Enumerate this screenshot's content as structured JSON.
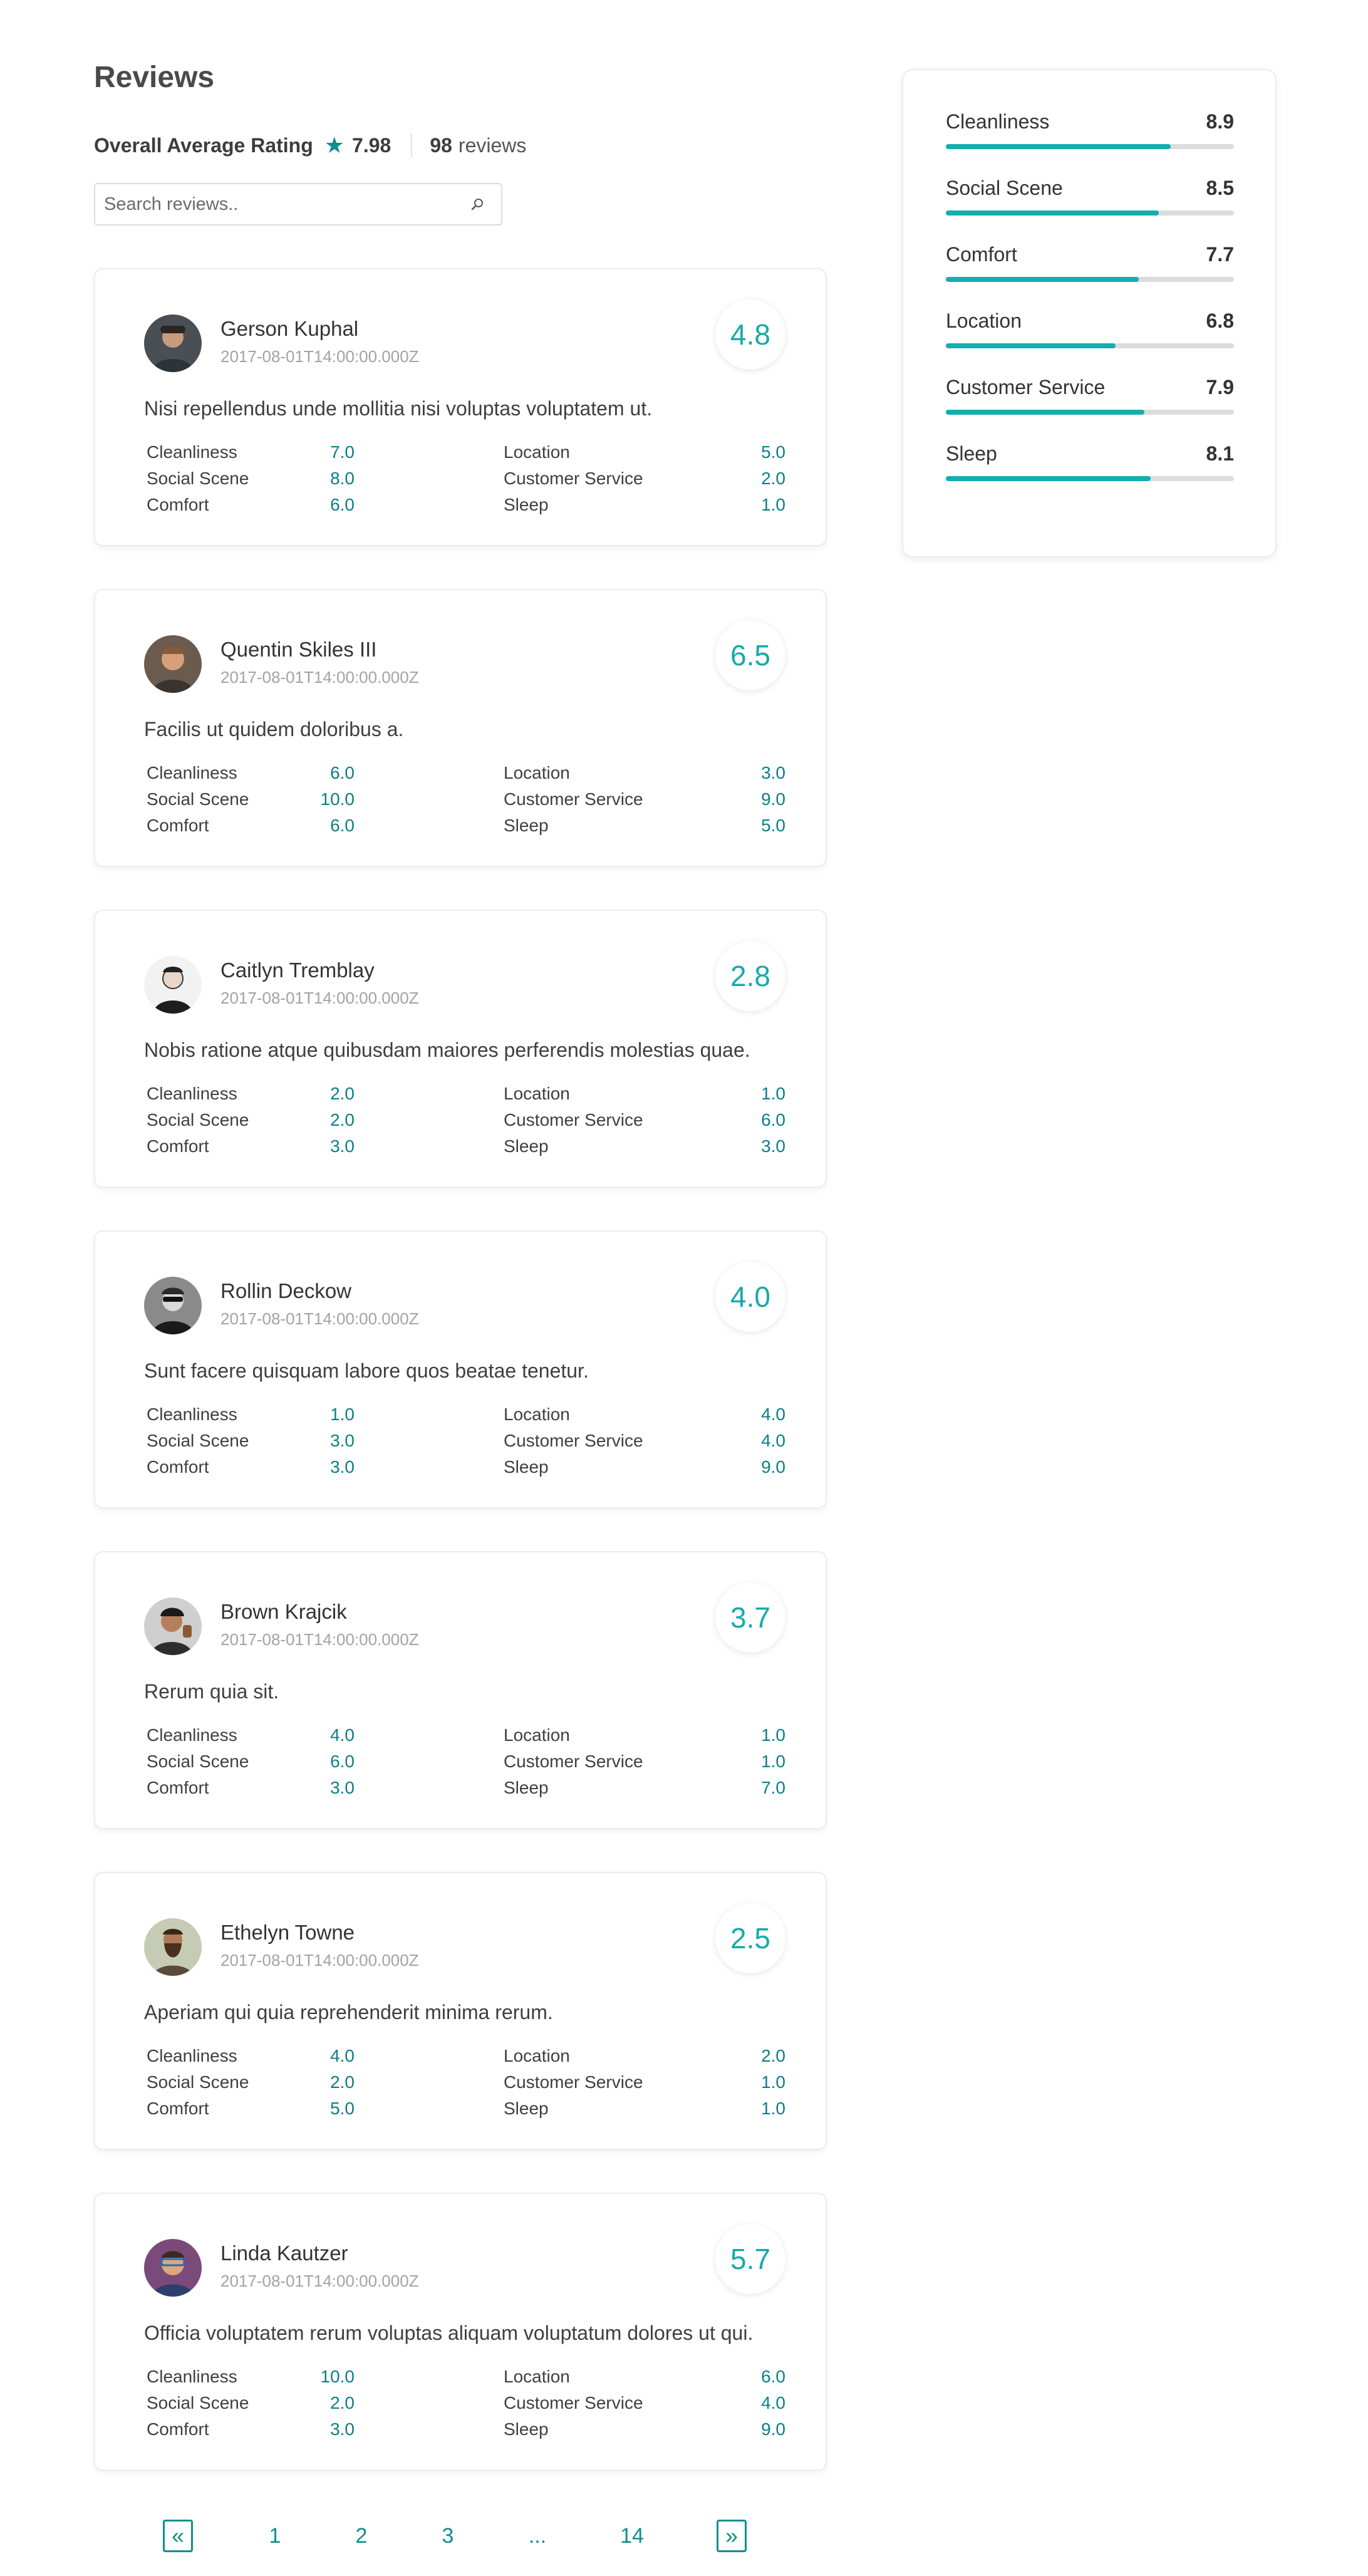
{
  "header": {
    "title": "Reviews",
    "overall_label": "Overall Average Rating",
    "overall_value": "7.98",
    "review_count": "98",
    "review_count_label": "reviews"
  },
  "search": {
    "placeholder": "Search reviews.."
  },
  "colors": {
    "accent": "#13aeae",
    "value_text": "#0a7f8a",
    "track": "#dcdcdc"
  },
  "summary": [
    {
      "label": "Cleanliness",
      "value": "8.9",
      "fraction": 0.78
    },
    {
      "label": "Social Scene",
      "value": "8.5",
      "fraction": 0.74
    },
    {
      "label": "Comfort",
      "value": "7.7",
      "fraction": 0.67
    },
    {
      "label": "Location",
      "value": "6.8",
      "fraction": 0.59
    },
    {
      "label": "Customer Service",
      "value": "7.9",
      "fraction": 0.69
    },
    {
      "label": "Sleep",
      "value": "8.1",
      "fraction": 0.71
    }
  ],
  "reviews": [
    {
      "name": "Gerson Kuphal",
      "date": "2017-08-01T14:00:00.000Z",
      "score": "4.8",
      "text": "Nisi repellendus unde mollitia nisi voluptas voluptatem ut.",
      "left": [
        [
          "Cleanliness",
          "7.0"
        ],
        [
          "Social Scene",
          "8.0"
        ],
        [
          "Comfort",
          "6.0"
        ]
      ],
      "right": [
        [
          "Location",
          "5.0"
        ],
        [
          "Customer Service",
          "2.0"
        ],
        [
          "Sleep",
          "1.0"
        ]
      ]
    },
    {
      "name": "Quentin Skiles III",
      "date": "2017-08-01T14:00:00.000Z",
      "score": "6.5",
      "text": "Facilis ut quidem doloribus a.",
      "left": [
        [
          "Cleanliness",
          "6.0"
        ],
        [
          "Social Scene",
          "10.0"
        ],
        [
          "Comfort",
          "6.0"
        ]
      ],
      "right": [
        [
          "Location",
          "3.0"
        ],
        [
          "Customer Service",
          "9.0"
        ],
        [
          "Sleep",
          "5.0"
        ]
      ]
    },
    {
      "name": "Caitlyn Tremblay",
      "date": "2017-08-01T14:00:00.000Z",
      "score": "2.8",
      "text": "Nobis ratione atque quibusdam maiores perferendis molestias quae.",
      "left": [
        [
          "Cleanliness",
          "2.0"
        ],
        [
          "Social Scene",
          "2.0"
        ],
        [
          "Comfort",
          "3.0"
        ]
      ],
      "right": [
        [
          "Location",
          "1.0"
        ],
        [
          "Customer Service",
          "6.0"
        ],
        [
          "Sleep",
          "3.0"
        ]
      ]
    },
    {
      "name": "Rollin Deckow",
      "date": "2017-08-01T14:00:00.000Z",
      "score": "4.0",
      "text": "Sunt facere quisquam labore quos beatae tenetur.",
      "left": [
        [
          "Cleanliness",
          "1.0"
        ],
        [
          "Social Scene",
          "3.0"
        ],
        [
          "Comfort",
          "3.0"
        ]
      ],
      "right": [
        [
          "Location",
          "4.0"
        ],
        [
          "Customer Service",
          "4.0"
        ],
        [
          "Sleep",
          "9.0"
        ]
      ]
    },
    {
      "name": "Brown Krajcik",
      "date": "2017-08-01T14:00:00.000Z",
      "score": "3.7",
      "text": "Rerum quia sit.",
      "left": [
        [
          "Cleanliness",
          "4.0"
        ],
        [
          "Social Scene",
          "6.0"
        ],
        [
          "Comfort",
          "3.0"
        ]
      ],
      "right": [
        [
          "Location",
          "1.0"
        ],
        [
          "Customer Service",
          "1.0"
        ],
        [
          "Sleep",
          "7.0"
        ]
      ]
    },
    {
      "name": "Ethelyn Towne",
      "date": "2017-08-01T14:00:00.000Z",
      "score": "2.5",
      "text": "Aperiam qui quia reprehenderit minima rerum.",
      "left": [
        [
          "Cleanliness",
          "4.0"
        ],
        [
          "Social Scene",
          "2.0"
        ],
        [
          "Comfort",
          "5.0"
        ]
      ],
      "right": [
        [
          "Location",
          "2.0"
        ],
        [
          "Customer Service",
          "1.0"
        ],
        [
          "Sleep",
          "1.0"
        ]
      ]
    },
    {
      "name": "Linda Kautzer",
      "date": "2017-08-01T14:00:00.000Z",
      "score": "5.7",
      "text": "Officia voluptatem rerum voluptas aliquam voluptatum dolores ut qui.",
      "left": [
        [
          "Cleanliness",
          "10.0"
        ],
        [
          "Social Scene",
          "2.0"
        ],
        [
          "Comfort",
          "3.0"
        ]
      ],
      "right": [
        [
          "Location",
          "6.0"
        ],
        [
          "Customer Service",
          "4.0"
        ],
        [
          "Sleep",
          "9.0"
        ]
      ]
    }
  ],
  "pagination": {
    "prev": "«",
    "pages": [
      "1",
      "2",
      "3",
      "...",
      "14"
    ],
    "next": "»"
  }
}
